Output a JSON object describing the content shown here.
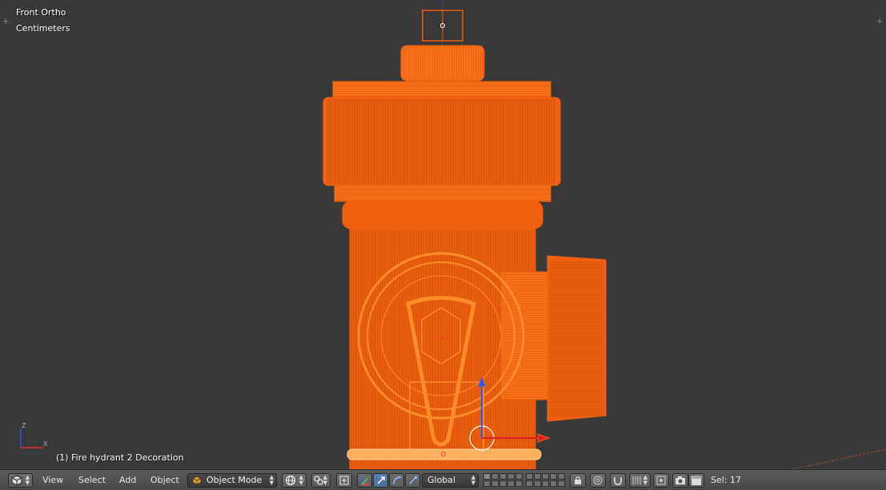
{
  "viewport": {
    "view_name": "Front Ortho",
    "units": "Centimeters",
    "object_info": "(1) Fire hydrant 2 Decoration",
    "axis_labels": {
      "z": "Z",
      "x": "X"
    },
    "colors": {
      "background": "#393939",
      "wire": "#f06010",
      "wire_light": "#ff8c2a",
      "selected_ring": "#ffb060"
    }
  },
  "header": {
    "editor_type_icon": "cube-view-icon",
    "menus": [
      {
        "label": "View"
      },
      {
        "label": "Select"
      },
      {
        "label": "Add"
      },
      {
        "label": "Object"
      }
    ],
    "mode": {
      "label": "Object Mode",
      "icon": "object-cube-icon"
    },
    "shading_icon": "sphere-shading-icon",
    "pivot_icon": "pivot-point-icon",
    "manipulator_icons": [
      "manipulator-toggle-icon",
      "translate-icon",
      "rotate-icon",
      "scale-icon"
    ],
    "orientation": {
      "label": "Global"
    },
    "selection": {
      "label": "Sel: 17"
    }
  }
}
